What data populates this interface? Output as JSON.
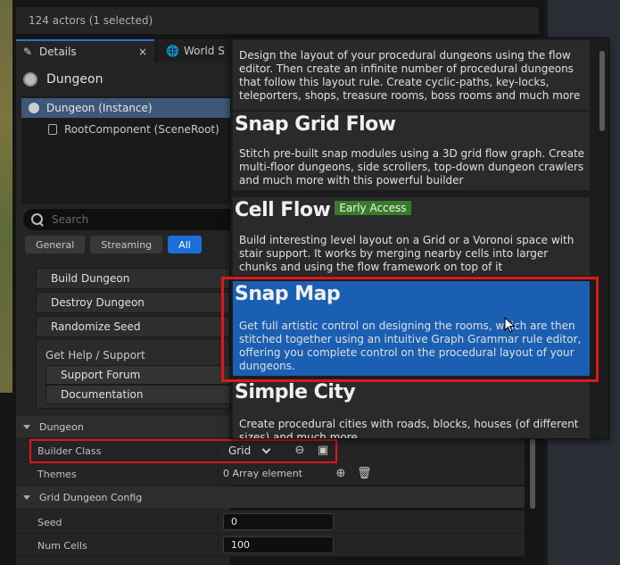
{
  "outliner": {
    "footer_text": "124 actors (1 selected)"
  },
  "tabs": [
    {
      "label": "Details",
      "close": "×"
    },
    {
      "label": "World S"
    }
  ],
  "details": {
    "actor_name": "Dungeon",
    "tree": [
      {
        "label": "Dungeon (Instance)"
      },
      {
        "label": "RootComponent (SceneRoot)"
      }
    ],
    "search_placeholder": "Search",
    "filters": [
      "General",
      "Streaming",
      "All"
    ],
    "buttons": [
      "Build Dungeon",
      "Destroy Dungeon",
      "Randomize Seed"
    ],
    "help": {
      "header": "Get Help / Support",
      "links": [
        "Support Forum",
        "Documentation"
      ]
    }
  },
  "sections": {
    "dungeon": "Dungeon",
    "grid_config": "Grid Dungeon Config"
  },
  "properties": {
    "builder_class": {
      "label": "Builder Class",
      "value": "Grid"
    },
    "themes": {
      "label": "Themes",
      "value": "0 Array element"
    },
    "seed": {
      "label": "Seed",
      "value": "0"
    },
    "num_cells": {
      "label": "Num Cells",
      "value": "100"
    }
  },
  "builders": [
    {
      "name": "",
      "desc": "Design the layout of your procedural dungeons using the flow editor. Then create an infinite number of procedural dungeons that follow this layout rule. Create cyclic-paths, key-locks, teleporters, shops, treasure rooms, boss rooms and much more"
    },
    {
      "name": "Snap Grid Flow",
      "desc": "Stitch pre-built snap modules using a 3D grid flow graph. Create multi-floor dungeons, side scrollers, top-down dungeon crawlers and much more with this powerful builder"
    },
    {
      "name": "Cell Flow",
      "badge": "Early Access",
      "desc": "Build interesting level layout on a Grid or a Voronoi space with stair support.  It works by merging nearby cells into larger chunks and using the flow framework on top of it"
    },
    {
      "name": "Snap Map",
      "desc": "Get full artistic control on designing the rooms, which are then stitched together using an intuitive Graph Grammar rule editor, offering you complete control on the procedural layout of your dungeons."
    },
    {
      "name": "Simple City",
      "desc": "Create procedural cities with roads, blocks, houses (of different sizes) and much more"
    }
  ],
  "colors": {
    "selected_item": "#1a5fb2",
    "highlight_box": "#e0161e",
    "early_access_badge": "#3a7a2f",
    "filter_active": "#1a6fd6"
  }
}
